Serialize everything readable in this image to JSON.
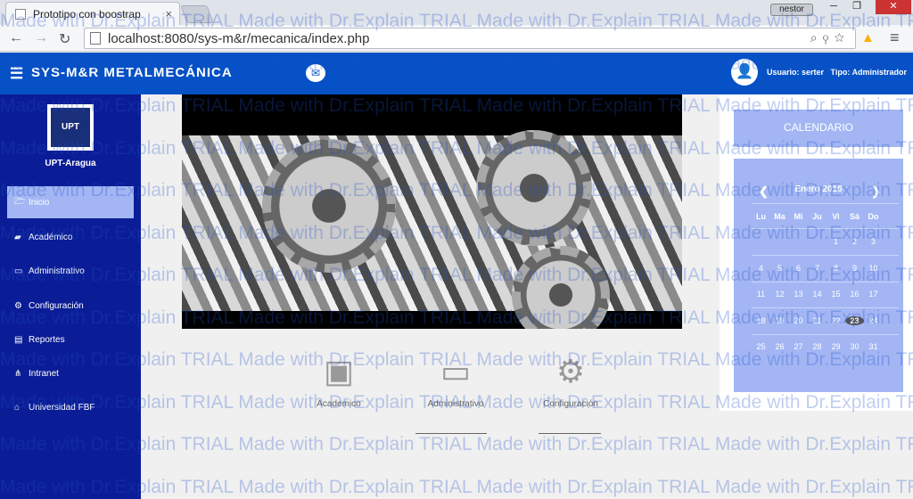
{
  "browser": {
    "tab_title": "Prototipo con boostrap",
    "url": "localhost:8080/sys-m&r/mecanica/index.php",
    "profile_name": "nestor"
  },
  "header": {
    "brand": "SYS-M&R  METALMECÁNICA",
    "user_label": "Usuario: serter",
    "type_label": "Tipo: Administrador"
  },
  "sidebar": {
    "campus": "UPT-Aragua",
    "logo_text": "UPT",
    "items": [
      {
        "label": "Inicio",
        "icon": "folder-open-icon",
        "glyph": "🗁"
      },
      {
        "label": "Académico",
        "icon": "book-icon",
        "glyph": "▰"
      },
      {
        "label": "Administrativo",
        "icon": "monitor-icon",
        "glyph": "▭"
      },
      {
        "label": "Configuración",
        "icon": "gears-icon",
        "glyph": "⚙"
      },
      {
        "label": "Reportes",
        "icon": "file-icon",
        "glyph": "▤"
      },
      {
        "label": "Intranet",
        "icon": "sitemap-icon",
        "glyph": "⋔"
      },
      {
        "label": "Universidad FBF",
        "icon": "institution-icon",
        "glyph": "⌂"
      }
    ]
  },
  "shortcuts": [
    {
      "label": "Academico",
      "icon": "wallet-icon",
      "glyph": "▣"
    },
    {
      "label": "Administrativo",
      "icon": "monitor-icon",
      "glyph": "▭"
    },
    {
      "label": "Configuración",
      "icon": "gear-icon",
      "glyph": "⚙"
    }
  ],
  "calendar": {
    "title": "CALENDARIO",
    "month": "Enero 2016",
    "prev": "❮",
    "next": "❯",
    "weekdays": [
      "Lu",
      "Ma",
      "Mi",
      "Ju",
      "Vi",
      "Sá",
      "Do"
    ],
    "weeks": [
      [
        "",
        "",
        "",
        "",
        "1",
        "2",
        "3"
      ],
      [
        "4",
        "5",
        "6",
        "7",
        "8",
        "9",
        "10"
      ],
      [
        "11",
        "12",
        "13",
        "14",
        "15",
        "16",
        "17"
      ],
      [
        "18",
        "19",
        "20",
        "21",
        "22",
        "23",
        "24"
      ],
      [
        "25",
        "26",
        "27",
        "28",
        "29",
        "30",
        "31"
      ]
    ],
    "today": "23"
  },
  "watermark": "Made with Dr.Explain TRIAL"
}
